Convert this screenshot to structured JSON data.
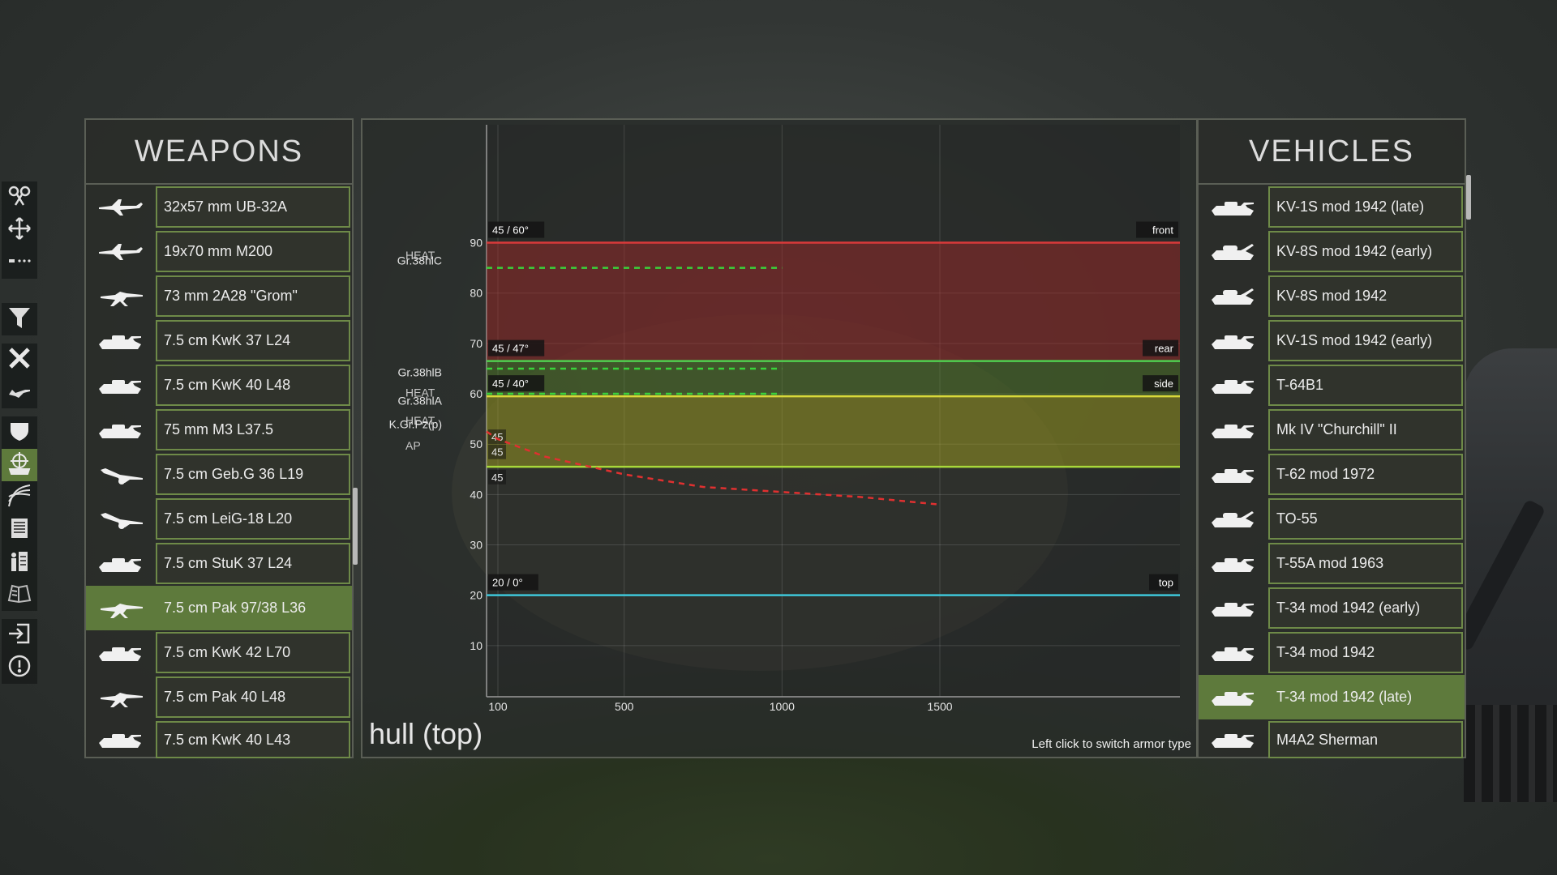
{
  "weapons": {
    "title": "WEAPONS",
    "items": [
      {
        "label": "32x57 mm UB-32A",
        "icon": "aircraft-icon",
        "selected": false
      },
      {
        "label": "19x70 mm M200",
        "icon": "aircraft-icon",
        "selected": false
      },
      {
        "label": "73 mm 2A28 \"Grom\"",
        "icon": "gun-icon",
        "selected": false
      },
      {
        "label": "7.5 cm KwK 37 L24",
        "icon": "tank-icon",
        "selected": false
      },
      {
        "label": "7.5 cm KwK 40 L48",
        "icon": "tank-icon",
        "selected": false
      },
      {
        "label": "75 mm M3 L37.5",
        "icon": "tank-icon",
        "selected": false
      },
      {
        "label": "7.5 cm Geb.G 36 L19",
        "icon": "field-gun-icon",
        "selected": false
      },
      {
        "label": "7.5 cm LeiG-18 L20",
        "icon": "field-gun-icon",
        "selected": false
      },
      {
        "label": "7.5 cm StuK 37 L24",
        "icon": "tank-icon",
        "selected": false
      },
      {
        "label": "7.5 cm Pak 97/38 L36",
        "icon": "gun-icon",
        "selected": true
      },
      {
        "label": "7.5 cm KwK 42 L70",
        "icon": "tank-icon",
        "selected": false
      },
      {
        "label": "7.5 cm Pak 40 L48",
        "icon": "gun-icon",
        "selected": false
      },
      {
        "label": "7.5 cm KwK 40 L43",
        "icon": "tank-icon",
        "selected": false
      }
    ]
  },
  "vehicles": {
    "title": "VEHICLES",
    "items": [
      {
        "label": "KV-1S mod 1942 (late)",
        "icon": "tank-icon",
        "selected": false
      },
      {
        "label": "KV-8S mod 1942 (early)",
        "icon": "flame-tank-icon",
        "selected": false
      },
      {
        "label": "KV-8S mod 1942",
        "icon": "flame-tank-icon",
        "selected": false
      },
      {
        "label": "KV-1S mod 1942 (early)",
        "icon": "tank-icon",
        "selected": false
      },
      {
        "label": "T-64B1",
        "icon": "tank-icon",
        "selected": false
      },
      {
        "label": "Mk IV \"Churchill\" II",
        "icon": "tank-icon",
        "selected": false
      },
      {
        "label": "T-62 mod 1972",
        "icon": "tank-icon",
        "selected": false
      },
      {
        "label": "TO-55",
        "icon": "flame-tank-icon",
        "selected": false
      },
      {
        "label": "T-55A mod 1963",
        "icon": "tank-icon",
        "selected": false
      },
      {
        "label": "T-34 mod 1942 (early)",
        "icon": "tank-icon",
        "selected": false
      },
      {
        "label": "T-34 mod 1942",
        "icon": "tank-icon",
        "selected": false
      },
      {
        "label": "T-34 mod 1942 (late)",
        "icon": "tank-icon",
        "selected": true
      },
      {
        "label": "M4A2 Sherman",
        "icon": "tank-icon",
        "selected": false
      }
    ]
  },
  "toolbar": {
    "tools": [
      {
        "icon": "compare-icon",
        "active": false
      },
      {
        "icon": "move-icon",
        "active": false
      },
      {
        "icon": "dots-icon",
        "active": false
      },
      {
        "icon": "filter-icon",
        "active": false
      },
      {
        "icon": "close-icon",
        "active": false
      },
      {
        "icon": "weapon-icon",
        "active": false
      },
      {
        "icon": "shield-icon",
        "active": false
      },
      {
        "icon": "penetration-icon",
        "active": true
      },
      {
        "icon": "ballistics-icon",
        "active": false
      },
      {
        "icon": "list-icon",
        "active": false
      },
      {
        "icon": "crew-icon",
        "active": false
      },
      {
        "icon": "encyclopedia-icon",
        "active": false
      },
      {
        "icon": "exit-icon",
        "active": false
      },
      {
        "icon": "info-icon",
        "active": false
      }
    ]
  },
  "chart_data": {
    "type": "line",
    "title": "hull (top)",
    "hint": "Left click to switch armor type",
    "xlim": [
      0,
      1650
    ],
    "ylim": [
      0,
      97
    ],
    "x_ticks": [
      100,
      500,
      1000,
      1500
    ],
    "y_ticks": [
      10,
      20,
      30,
      40,
      50,
      60,
      70,
      80,
      90
    ],
    "grid": true,
    "armor_bands": [
      {
        "name": "front",
        "value": 90,
        "label": "45 / 60°",
        "color": "#d93a3a",
        "fill_from": 66.5
      },
      {
        "name": "rear",
        "value": 66.5,
        "label": "45 / 47°",
        "color": "#4fcf4f",
        "fill_from": 59.5
      },
      {
        "name": "side",
        "value": 59.5,
        "label": "45 / 40°",
        "color": "#d8d83a",
        "fill_from": 45.5
      },
      {
        "name": "top",
        "value": 20,
        "label": "20 / 0°",
        "color": "#3ec6d8",
        "fill_from": null
      }
    ],
    "band_base_line": {
      "value": 45.5,
      "color": "#a8d83a"
    },
    "side_stack_labels": [
      "45",
      "45",
      "45"
    ],
    "ammo": [
      {
        "name": "Gr.38hlC",
        "type": "HEAT",
        "y": 85,
        "x_range": [
          0,
          1000
        ],
        "color": "#3ad23a",
        "style": "dashed"
      },
      {
        "name": "Gr.38hlB",
        "type": "HEAT",
        "y": 65,
        "x_range": [
          0,
          1000
        ],
        "color": "#3ad23a",
        "style": "dashed"
      },
      {
        "name": "Gr.38hlA",
        "type": "HEAT",
        "y": 60,
        "x_range": [
          0,
          1000
        ],
        "color": "#3ad23a",
        "style": "dashed"
      },
      {
        "name": "K.Gr.Pz(p)",
        "type": "AP",
        "x": [
          0,
          100,
          250,
          500,
          750,
          1000,
          1250,
          1500
        ],
        "y": [
          52.5,
          51,
          47.5,
          44,
          41.5,
          40.5,
          39.5,
          38
        ],
        "color": "#e03030",
        "style": "dashed"
      }
    ]
  }
}
